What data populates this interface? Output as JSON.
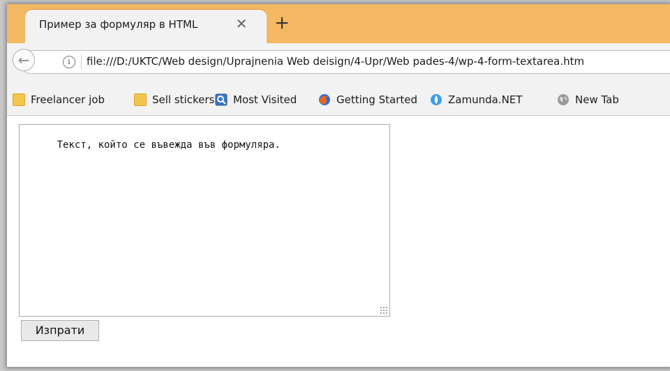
{
  "tab": {
    "title": "Пример за формуляр в HTML",
    "close_glyph": "✕",
    "new_tab_glyph": "+"
  },
  "navbar": {
    "back_glyph": "←",
    "info_glyph": "i",
    "url": "file:///D:/UKTC/Web design/Uprajnenia Web deisign/4-Upr/Web pades-4/wp-4-form-textarea.htm"
  },
  "bookmarks": [
    {
      "label": "Freelancer job",
      "icon": "folder-icon"
    },
    {
      "label": "Sell stickers",
      "icon": "folder-icon"
    },
    {
      "label": "Most Visited",
      "icon": "most-visited-icon"
    },
    {
      "label": "Getting Started",
      "icon": "firefox-icon"
    },
    {
      "label": "Zamunda.NET",
      "icon": "zamunda-icon"
    },
    {
      "label": "New Tab",
      "icon": "globe-icon"
    }
  ],
  "form": {
    "textarea_value": "Текст, който се въвежда във формуляра.",
    "submit_label": "Изпрати"
  },
  "colors": {
    "tabbar": "#f5b862",
    "chrome": "#f2f2f2"
  }
}
